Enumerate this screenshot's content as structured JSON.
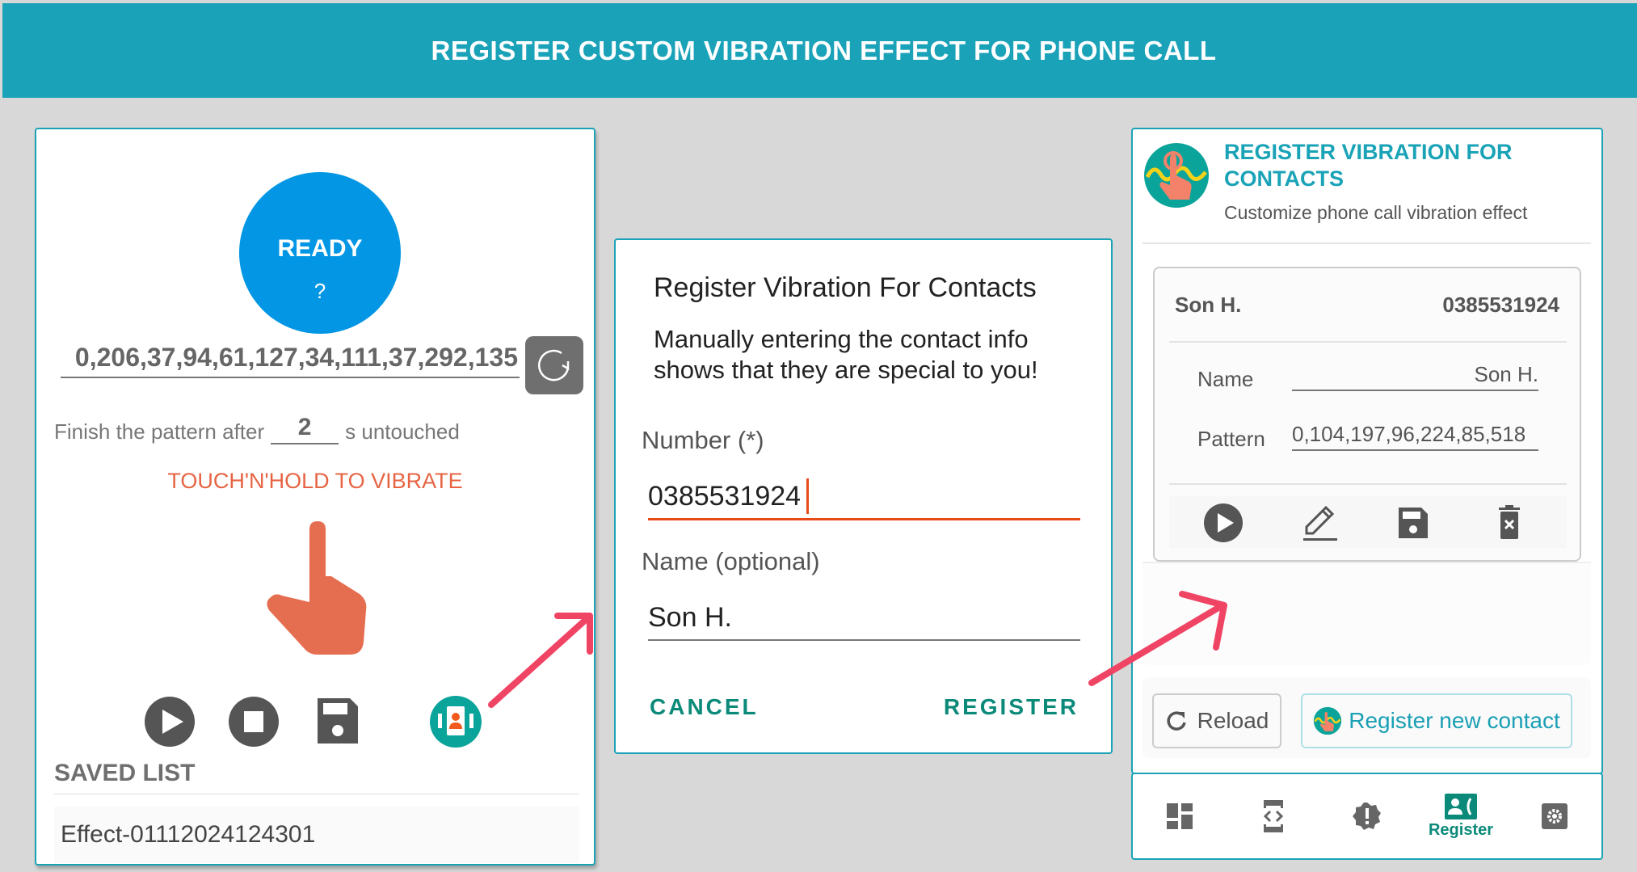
{
  "header": {
    "title": "REGISTER CUSTOM VIBRATION EFFECT FOR PHONE CALL"
  },
  "colors": {
    "header_bg": "#19a2b8",
    "accent": "#1aa3b7",
    "status_blue": "#0296e4",
    "touch_orange": "#e66444",
    "button_teal": "#0b8a7a",
    "arrow_pink": "#f04464"
  },
  "left_panel": {
    "status": {
      "label": "READY",
      "sub": "?"
    },
    "pattern_value": "...0,206,37,94,61,127,34,111,37,292,135",
    "pattern_visible": "0,206,37,94,61,127,34,111,37,292,135",
    "finish_prefix": "Finish the pattern after",
    "finish_seconds": "2",
    "finish_suffix": "s untouched",
    "touch_hint": "TOUCH'N'HOLD TO VIBRATE",
    "controls": [
      "play-icon",
      "stop-icon",
      "save-icon",
      "register-contact-icon"
    ],
    "saved_title": "SAVED LIST",
    "saved_items": [
      "Effect-01112024124301"
    ]
  },
  "dialog": {
    "title": "Register Vibration For Contacts",
    "message_line1": "Manually entering the contact info",
    "message_line2": "shows that they are special to you!",
    "number_label": "Number (*)",
    "number_value": "0385531924",
    "name_label": "Name (optional)",
    "name_value": "Son H.",
    "cancel_label": "CANCEL",
    "register_label": "REGISTER"
  },
  "right_panel": {
    "title_line1": "REGISTER VIBRATION FOR",
    "title_line2": "CONTACTS",
    "subtitle": "Customize phone call vibration effect",
    "contact": {
      "name": "Son H.",
      "number": "0385531924",
      "name_label": "Name",
      "name_value": "Son H.",
      "pattern_label": "Pattern",
      "pattern_value": "0,104,197,96,224,85,518"
    },
    "reload_label": "Reload",
    "register_new_label": "Register new contact"
  },
  "bottom_nav": {
    "items": [
      {
        "icon": "dashboard-icon",
        "label": ""
      },
      {
        "icon": "developer-mode-icon",
        "label": ""
      },
      {
        "icon": "new-releases-icon",
        "label": ""
      },
      {
        "icon": "contact-phone-icon",
        "label": "Register",
        "active": true
      },
      {
        "icon": "settings-icon",
        "label": ""
      }
    ]
  }
}
